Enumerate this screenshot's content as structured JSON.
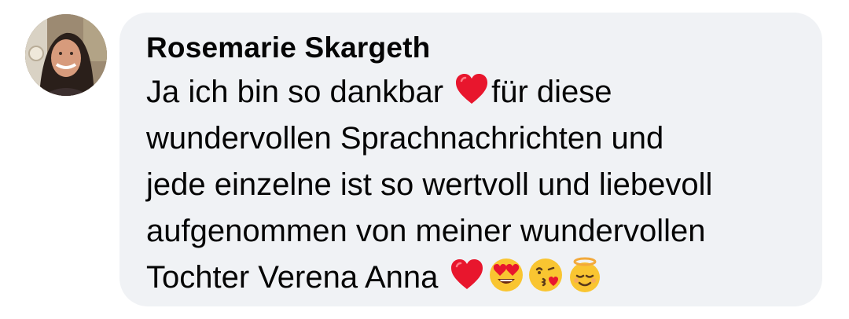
{
  "comment": {
    "author": "Rosemarie Skargeth",
    "avatar_icon": "profile-photo-avatar",
    "text_parts": {
      "part1": "Ja ich bin so dankbar ",
      "part2": "für diese\nwundervollen Sprachnachrichten und\njede einzelne ist so wertvoll und liebevoll\naufgenommen von meiner wundervollen\nTochter Verena Anna "
    },
    "emojis": {
      "inline": "red-heart",
      "trailing": [
        "red-heart",
        "heart-eyes-face",
        "face-blowing-kiss",
        "smiling-face-with-halo"
      ]
    },
    "colors": {
      "bubble_bg": "#f0f2f5",
      "text": "#050505",
      "heart": "#e8162d",
      "emoji_face": "#f9c531"
    }
  }
}
